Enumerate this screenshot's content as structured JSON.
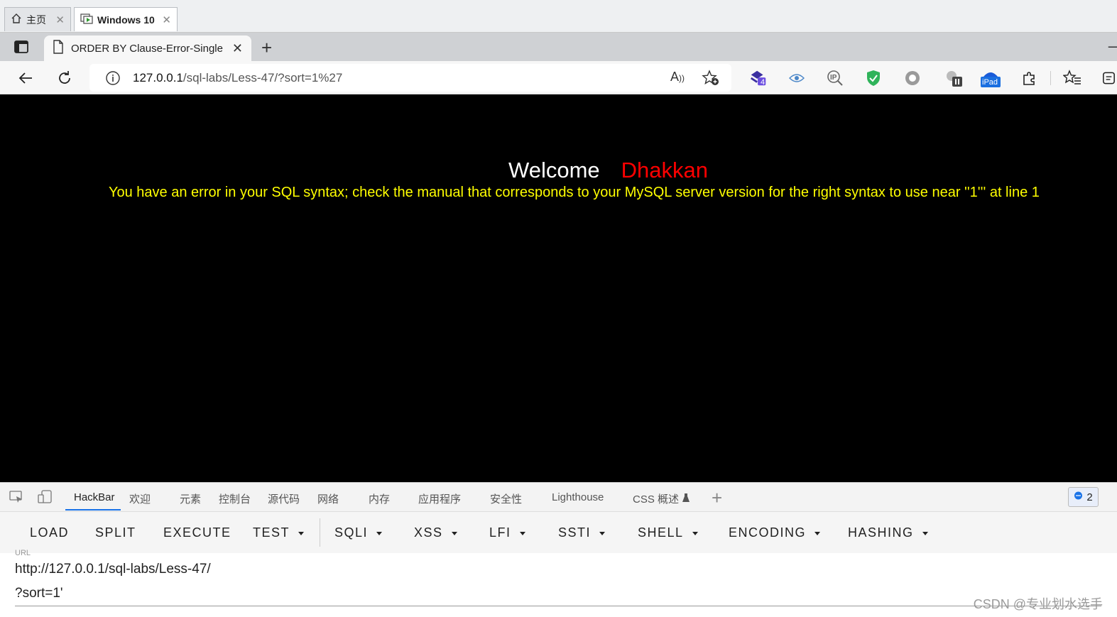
{
  "vm_tabs": [
    {
      "label": "主页"
    },
    {
      "label": "Windows 10"
    }
  ],
  "browser": {
    "tab_title": "ORDER BY Clause-Error-Single quote",
    "url_host": "127.0.0.1",
    "url_path": "/sql-labs/Less-47/?sort=1%27",
    "read_aloud_label": "A",
    "extension_badge": "4",
    "ipad_label": "iPad"
  },
  "page": {
    "welcome": "Welcome",
    "name": "Dhakkan",
    "error": "You have an error in your SQL syntax; check the manual that corresponds to your MySQL server version for the right syntax to use near ''1''' at line 1",
    "background": "#000000",
    "name_color": "#ff0000",
    "error_color": "#ffff00"
  },
  "devtools": {
    "tabs": [
      "HackBar",
      "欢迎",
      "元素",
      "控制台",
      "源代码",
      "网络",
      "内存",
      "应用程序",
      "安全性",
      "Lighthouse",
      "CSS 概述"
    ],
    "issues_count": "2"
  },
  "hackbar": {
    "buttons": [
      "LOAD",
      "SPLIT",
      "EXECUTE",
      "TEST",
      "SQLI",
      "XSS",
      "LFI",
      "SSTI",
      "SHELL",
      "ENCODING",
      "HASHING"
    ],
    "url_label": "URL",
    "url_line1": "http://127.0.0.1/sql-labs/Less-47/",
    "url_line2": "?sort=1'"
  },
  "watermark": "CSDN @专业划水选手"
}
